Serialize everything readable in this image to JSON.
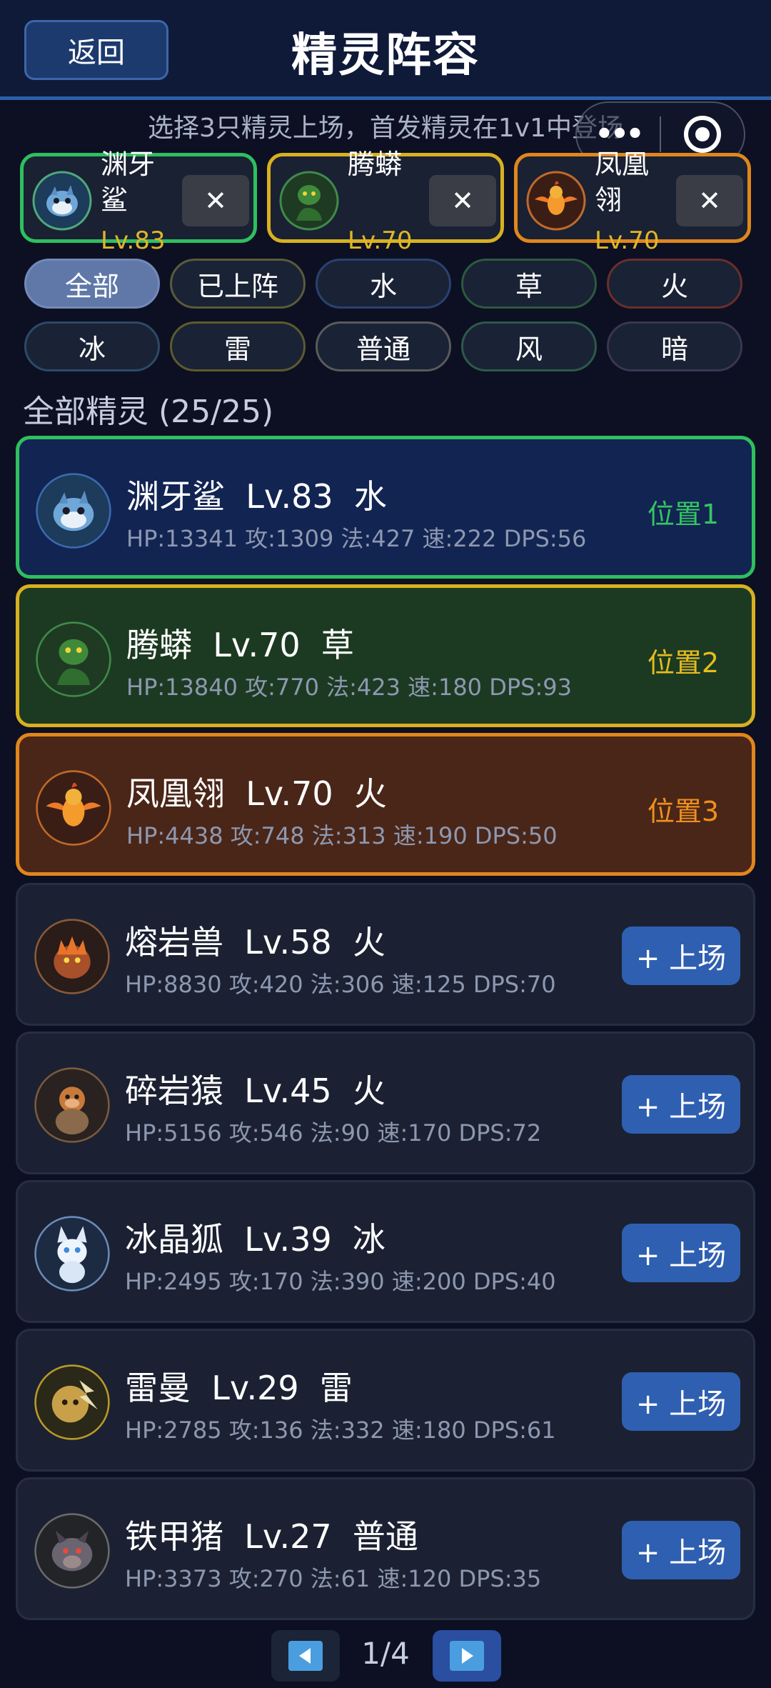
{
  "header": {
    "back_label": "返回",
    "title": "精灵阵容"
  },
  "capsule": {
    "more_label": "•••"
  },
  "hint": "选择3只精灵上场，首发精灵在1v1中登场",
  "slots": [
    {
      "name": "渊牙鲨",
      "level": "Lv.83",
      "border": "#2fbf5f",
      "remove": "✕"
    },
    {
      "name": "腾蟒",
      "level": "Lv.70",
      "border": "#d8b020",
      "remove": "✕"
    },
    {
      "name": "凤凰翎",
      "level": "Lv.70",
      "border": "#e0861c",
      "remove": "✕"
    }
  ],
  "filters": [
    {
      "label": "全部",
      "active": true,
      "border": "#7389b8"
    },
    {
      "label": "已上阵",
      "active": false,
      "border": "#5b5a3a"
    },
    {
      "label": "水",
      "active": false,
      "border": "#2a4170"
    },
    {
      "label": "草",
      "active": false,
      "border": "#2c5a3c"
    },
    {
      "label": "火",
      "active": false,
      "border": "#6a2e2e"
    },
    {
      "label": "冰",
      "active": false,
      "border": "#2c4a66"
    },
    {
      "label": "雷",
      "active": false,
      "border": "#5e5a2e"
    },
    {
      "label": "普通",
      "active": false,
      "border": "#5a5a5a"
    },
    {
      "label": "风",
      "active": false,
      "border": "#2d5a48"
    },
    {
      "label": "暗",
      "active": false,
      "border": "#3a3650"
    }
  ],
  "section_label": "全部精灵 (25/25)",
  "sprites": [
    {
      "title": "渊牙鲨  Lv.83  水",
      "stats": "HP:13341 攻:1309 法:427 速:222 DPS:56",
      "position": "位置1",
      "position_color": "#35c463",
      "state": "selected-1"
    },
    {
      "title": "腾蟒  Lv.70  草",
      "stats": "HP:13840 攻:770 法:423 速:180 DPS:93",
      "position": "位置2",
      "position_color": "#e6bd1e",
      "state": "selected-2"
    },
    {
      "title": "凤凰翎  Lv.70  火",
      "stats": "HP:4438 攻:748 法:313 速:190 DPS:50",
      "position": "位置3",
      "position_color": "#f0901e",
      "state": "selected-3"
    },
    {
      "title": "熔岩兽  Lv.58  火",
      "stats": "HP:8830 攻:420 法:306 速:125 DPS:70",
      "button": "+ 上场",
      "state": "unselected"
    },
    {
      "title": "碎岩猿  Lv.45  火",
      "stats": "HP:5156 攻:546 法:90 速:170 DPS:72",
      "button": "+ 上场",
      "state": "unselected"
    },
    {
      "title": "冰晶狐  Lv.39  冰",
      "stats": "HP:2495 攻:170 法:390 速:200 DPS:40",
      "button": "+ 上场",
      "state": "unselected"
    },
    {
      "title": "雷曼  Lv.29  雷",
      "stats": "HP:2785 攻:136 法:332 速:180 DPS:61",
      "button": "+ 上场",
      "state": "unselected"
    },
    {
      "title": "铁甲猪  Lv.27  普通",
      "stats": "HP:3373 攻:270 法:61 速:120 DPS:35",
      "button": "+ 上场",
      "state": "unselected"
    }
  ],
  "pagination": {
    "indicator": "1/4"
  }
}
